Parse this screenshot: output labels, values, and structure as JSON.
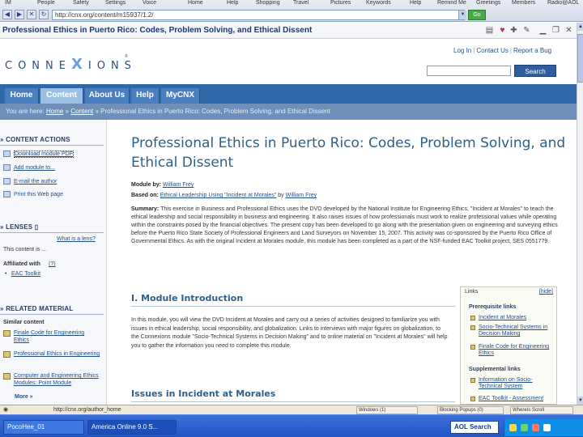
{
  "browser": {
    "menu_items": [
      "IM",
      "People",
      "Safety",
      "Settings",
      "Voice",
      "Home",
      "Help",
      "Shopping",
      "Travel",
      "Pictures",
      "Keywords",
      "Help",
      "Remind Me",
      "Greetings",
      "Members",
      "Radio@AOL"
    ],
    "address_url": "http://cnx.org/content/m15937/1.2/",
    "go_label": "Go"
  },
  "page_title": "Professional Ethics in Puerto Rico: Codes, Problem Solving, and Ethical Dissent",
  "header": {
    "logo_text": "CONNE",
    "logo_x": "X",
    "logo_text_end": "IONS",
    "logo_reg": "®",
    "links": [
      "Log In",
      "Contact Us",
      "Report a Bug"
    ],
    "search_label": "Search"
  },
  "tabs": [
    "Home",
    "Content",
    "About Us",
    "Help",
    "MyCNX"
  ],
  "breadcrumb": {
    "prefix": "You are here: ",
    "home": "Home",
    "sep": " » ",
    "content": "Content",
    "current": "Professional Ethics in Puerto Rico: Codes, Problem Solving, and Ethical Dissent"
  },
  "sidebar": {
    "content_actions_title": "CONTENT ACTIONS",
    "actions": [
      "Download module PDF",
      "Add module to...",
      "E-mail the author",
      "Print this Web page"
    ],
    "lenses_title": "LENSES",
    "whats_lens": "What is a lens?",
    "this_content_is": "This content is ...",
    "affiliated_with": "Affiliated with",
    "affiliated_help": "(?)",
    "affiliated_item": "EAC Toolkit",
    "related_title": "RELATED MATERIAL",
    "similar_content": "Similar content",
    "related_items": [
      "Finale Code for Engineering Ethics",
      "Professional Ethics in Engineering",
      "Computer and Engineering Ethics Modules: Point Module"
    ],
    "more": "More »"
  },
  "main": {
    "module_by_label": "Module by:",
    "module_by": "William Frey",
    "based_on_label": "Based on:",
    "based_on": "Ethical Leadership Using \"Incident at Morales\"",
    "based_on_by": " by ",
    "based_on_author": "William Frey",
    "summary_label": "Summary:",
    "summary": "This exercise in Business and Professional Ethics uses the DVD developed by the National Institute for Engineering Ethics, \"Incident at Morales\" to teach the ethical leadership and social responsibility in business and engineering. It also raises issues of how professionals must work to realize professional values while operating within the constraints posed by the financial objectives. The present copy has been developed to go along with the presentation given on engineering and surveying ethics before the Puerto Rico State Society of Professional Engineers and Land Surveyors on November 15, 2007. This activity was co-sponsored by the Puerto Rico Office of Governmental Ethics. As with the original Incident at Morales module, this module has been completed as a part of the NSF-funded EAC Toolkit project, SES 0551779.",
    "section1": "I. Module Introduction",
    "intro": "In this module, you will view the DVD Incident at Morales and carry out a series of activities designed to familiarize you with issues in ethical leadership, social responsibility, and globalization. Links to interviews with major figures on globalization, to the Connexions module \"Socio-Technical Systems in Decision Making\" and to online material on \"Incident at Morales\" will help you to gather the information you need to complete this module.",
    "section2": "Issues in Incident at Morales"
  },
  "links_box": {
    "title": "Links",
    "hide": "[hide]",
    "prereq_title": "Prerequisite links",
    "prereq": [
      "Incident at Morales",
      "Socio-Technical Systems in Decision Making",
      "Finale Code for Engineering Ethics"
    ],
    "supp_title": "Supplemental links",
    "supp": [
      "Information on Socio-Technical System",
      "EAC Toolkit - Assessment"
    ]
  },
  "status": {
    "url": "http://cnx.org/author_home",
    "boxes": [
      "Windows (1)",
      "Blocking Popups (0)",
      "WhereIs Scroll"
    ]
  },
  "taskbar": {
    "items": [
      "PocoHee_01",
      "America Online 9.0 S..."
    ],
    "aol_search": "AOL Search"
  }
}
